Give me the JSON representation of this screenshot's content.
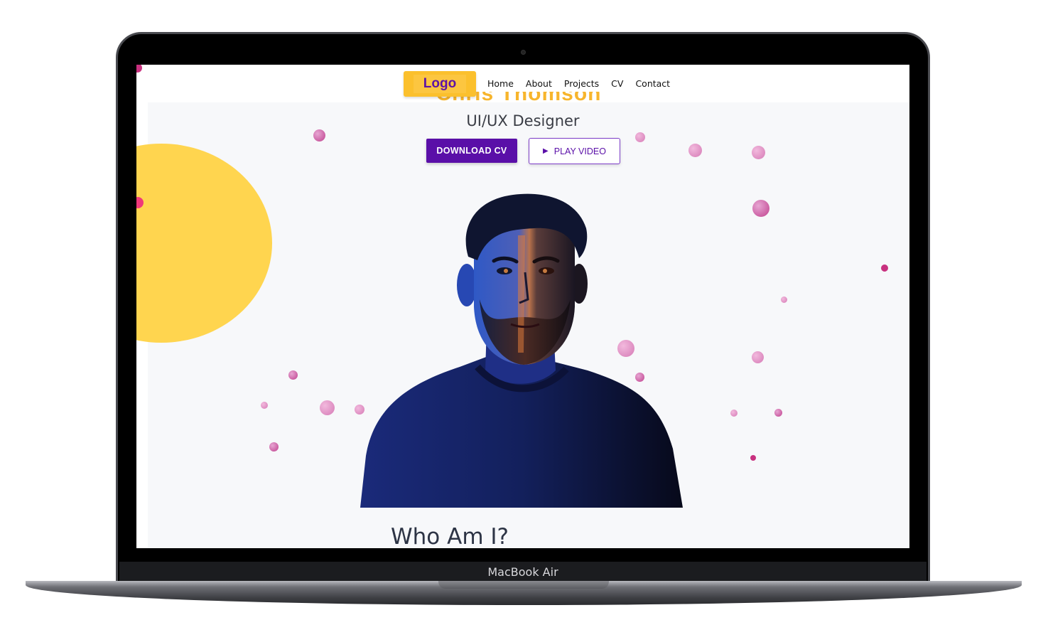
{
  "device": {
    "brand_label": "MacBook Air"
  },
  "header": {
    "logo_label": "Logo",
    "hero_title_peek": "Chris Thomson",
    "nav": [
      "Home",
      "About",
      "Projects",
      "CV",
      "Contact"
    ]
  },
  "hero": {
    "subtitle": "UI/UX Designer",
    "download_label": "DOWNLOAD CV",
    "play_label": "PLAY VIDEO",
    "play_icon": "play-icon"
  },
  "about": {
    "heading": "Who Am I?"
  },
  "colors": {
    "brand_purple": "#5a0fa8",
    "accent_yellow": "#fbc02d",
    "sun_yellow": "#ffd54f",
    "dot_pink": "#c8317f",
    "page_bg": "#f7f8fa"
  }
}
